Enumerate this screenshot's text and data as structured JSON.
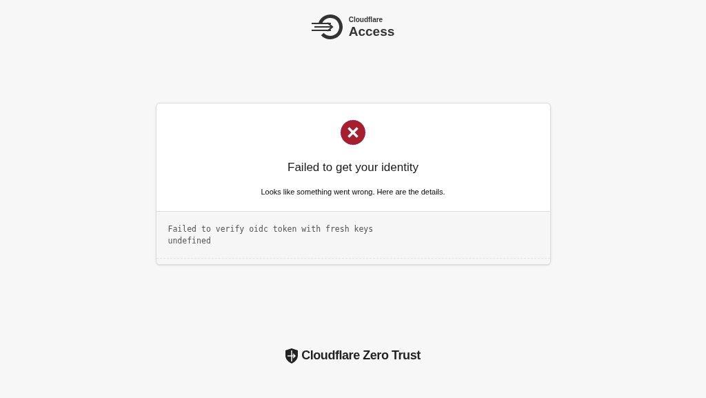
{
  "header": {
    "brand_small": "Cloudflare",
    "brand_large": "Access"
  },
  "card": {
    "title": "Failed to get your identity",
    "message": "Looks like something went wrong. Here are the details.",
    "details": [
      "Failed to verify oidc token with fresh keys",
      "undefined"
    ]
  },
  "footer": {
    "brand": "Cloudflare Zero Trust"
  }
}
